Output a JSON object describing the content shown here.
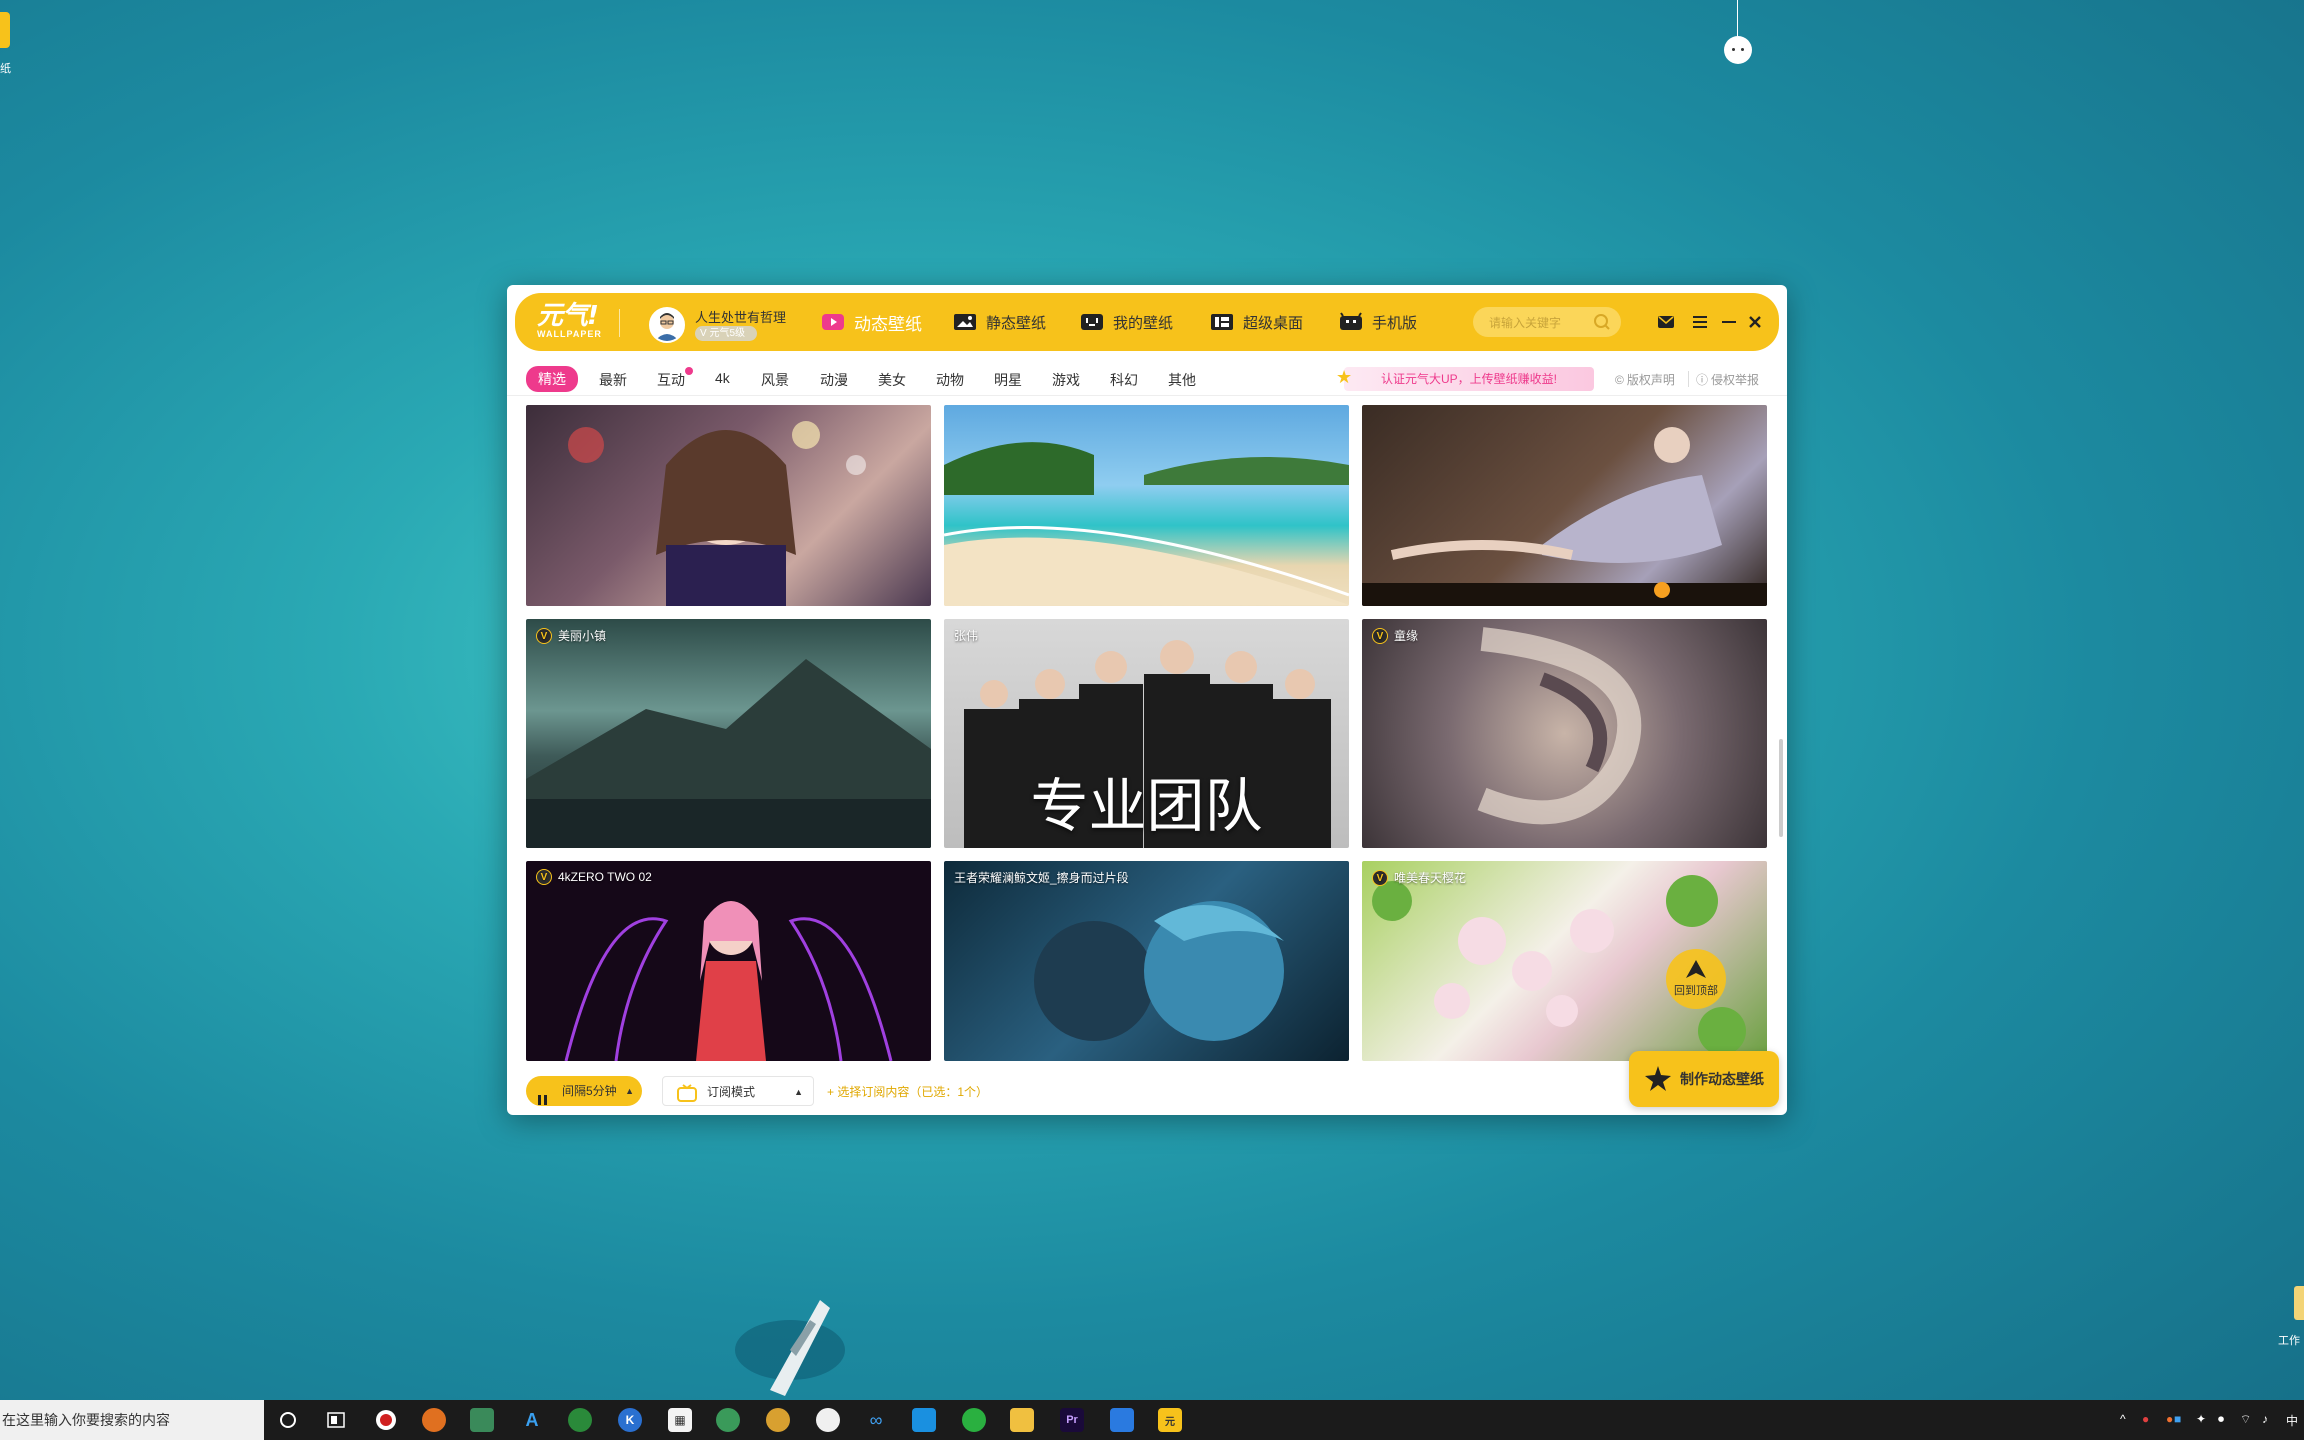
{
  "desktop": {
    "left_icon_label": "纸",
    "right_icon_label": "工作"
  },
  "app": {
    "logo_text": "元气!",
    "logo_sub": "WALLPAPER",
    "user": {
      "name": "人生处世有哲理",
      "badge": "V 元气5级"
    },
    "nav": [
      {
        "label": "动态壁纸",
        "icon": "play-icon",
        "active": true
      },
      {
        "label": "静态壁纸",
        "icon": "image-icon",
        "active": false
      },
      {
        "label": "我的壁纸",
        "icon": "tv-icon",
        "active": false
      },
      {
        "label": "超级桌面",
        "icon": "desktop-icon",
        "active": false
      },
      {
        "label": "手机版",
        "icon": "android-icon",
        "active": false
      }
    ],
    "search": {
      "placeholder": "请输入关键字"
    },
    "window_controls": [
      "mail-icon",
      "menu-icon",
      "minimize-icon",
      "close-icon"
    ],
    "categories": [
      "精选",
      "最新",
      "互动",
      "4k",
      "风景",
      "动漫",
      "美女",
      "动物",
      "明星",
      "游戏",
      "科幻",
      "其他"
    ],
    "active_category": "精选",
    "promo": "认证元气大UP，上传壁纸赚收益!",
    "links": {
      "copyright": "版权声明",
      "report": "侵权举报"
    },
    "tiles": [
      {
        "title": "",
        "vip": false,
        "theme": "anime-girl"
      },
      {
        "title": "",
        "vip": false,
        "theme": "beach"
      },
      {
        "title": "",
        "vip": false,
        "theme": "fantasy-woman"
      },
      {
        "title": "美丽小镇",
        "vip": true,
        "theme": "mountain-town"
      },
      {
        "title": "张伟",
        "vip": false,
        "theme": "team",
        "overlay": "专业团队"
      },
      {
        "title": "童缘",
        "vip": true,
        "theme": "swirl"
      },
      {
        "title": "4kZERO TWO 02",
        "vip": true,
        "theme": "zero-two"
      },
      {
        "title": "王者荣耀澜鲸文姬_擦身而过片段",
        "vip": false,
        "theme": "underwater"
      },
      {
        "title": "唯美春天樱花",
        "vip": true,
        "theme": "sakura"
      }
    ],
    "back_to_top": "回到顶部",
    "bottom": {
      "interval": "间隔5分钟",
      "mode": "订阅模式",
      "subscribe_link": "+ 选择订阅内容（已选：1个）",
      "make_button": "制作动态壁纸"
    }
  },
  "taskbar": {
    "search_placeholder": "在这里输入你要搜索的内容",
    "tray_lang": "中"
  }
}
